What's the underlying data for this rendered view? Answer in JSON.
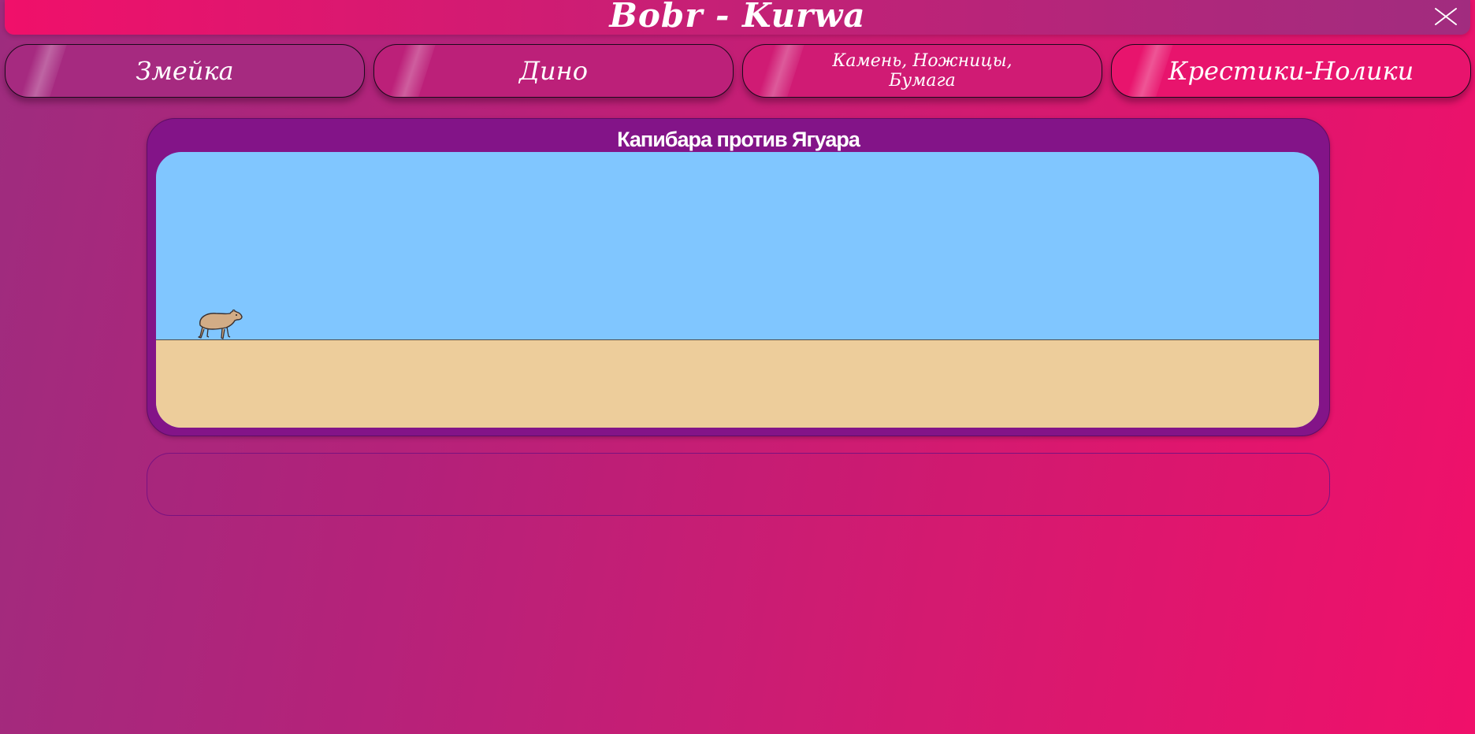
{
  "header": {
    "title": "Bobr - Kurwa",
    "close_icon": "close-icon"
  },
  "nav": {
    "items": [
      {
        "label": "Змейка"
      },
      {
        "label": "Дино"
      },
      {
        "label": "Камень, Ножницы, Бумага"
      },
      {
        "label": "Крестики-Нолики"
      }
    ]
  },
  "game": {
    "title": "Капибара против Ягуара",
    "player_icon": "capybara-icon"
  },
  "colors": {
    "sky": "#80c6ff",
    "ground": "#edcd9b",
    "panel": "#831488",
    "accent_pink": "#f0106a",
    "accent_purple": "#9e2c7e"
  }
}
